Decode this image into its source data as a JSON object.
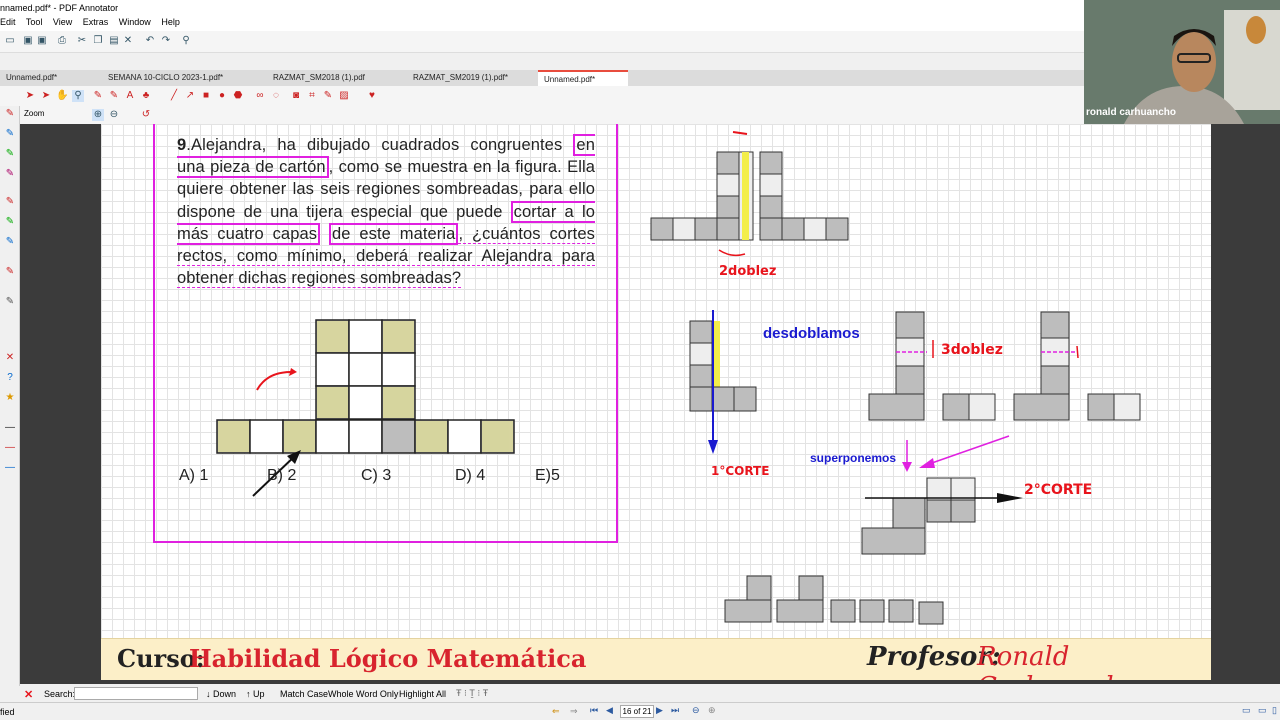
{
  "window": {
    "title": "nnamed.pdf* - PDF Annotator"
  },
  "menu": [
    "Edit",
    "Tool",
    "View",
    "Extras",
    "Window",
    "Help"
  ],
  "tabs": [
    {
      "label": "Unnamed.pdf*",
      "active": false
    },
    {
      "label": "SEMANA 10-CICLO 2023-1.pdf*",
      "active": false
    },
    {
      "label": "RAZMAT_SM2018 (1).pdf",
      "active": false
    },
    {
      "label": "RAZMAT_SM2019 (1).pdf*",
      "active": false
    },
    {
      "label": "Unnamed.pdf*",
      "active": true
    }
  ],
  "toolbar": {
    "zoom_label": "Zoom"
  },
  "webcam": {
    "name": "ronald carhuancho"
  },
  "problem": {
    "number": "9",
    "text_1": ".Alejandra, ha dibujado cuadrados congruentes",
    "text_hl1": "en una pieza de cartón",
    "text_2": ", como se muestra en la figura. Ella quiere obtener las seis regiones sombreadas, para ello dispone de una tijera especial que puede",
    "text_hl2": "cortar a lo más cuatro capas",
    "text_hl3": "de este materia",
    "text_3": ", ¿cuántos cortes rectos, como mínimo, deberá realizar Alejandra para obtener dichas regiones sombreadas?",
    "answers": [
      "A) 1",
      "B) 2",
      "C) 3",
      "D) 4",
      "E)5"
    ]
  },
  "annotations": {
    "doblez2": "2doblez",
    "desdoblamos": "desdoblamos",
    "doblez3": "3doblez",
    "corte1": "1°CORTE",
    "superponemos": "superponemos",
    "corte2": "2°CORTE"
  },
  "footer": {
    "course_label": "Curso:",
    "course_name": "Habilidad Lógico Matemática",
    "prof_label": "Profesor:",
    "prof_name": "Ronald Carhuancho"
  },
  "search": {
    "label": "Search:",
    "value": "",
    "down": "Down",
    "up": "Up",
    "match_case": "Match Case",
    "whole_word": "Whole Word Only",
    "highlight_all": "Highlight All"
  },
  "status": {
    "left": "fied",
    "page": "16 of 21"
  },
  "colors": {
    "highlight": "#e020e0",
    "annotation_red": "#e8141c",
    "annotation_blue": "#1a1ad0",
    "cell_gray": "#bdbdbd"
  }
}
